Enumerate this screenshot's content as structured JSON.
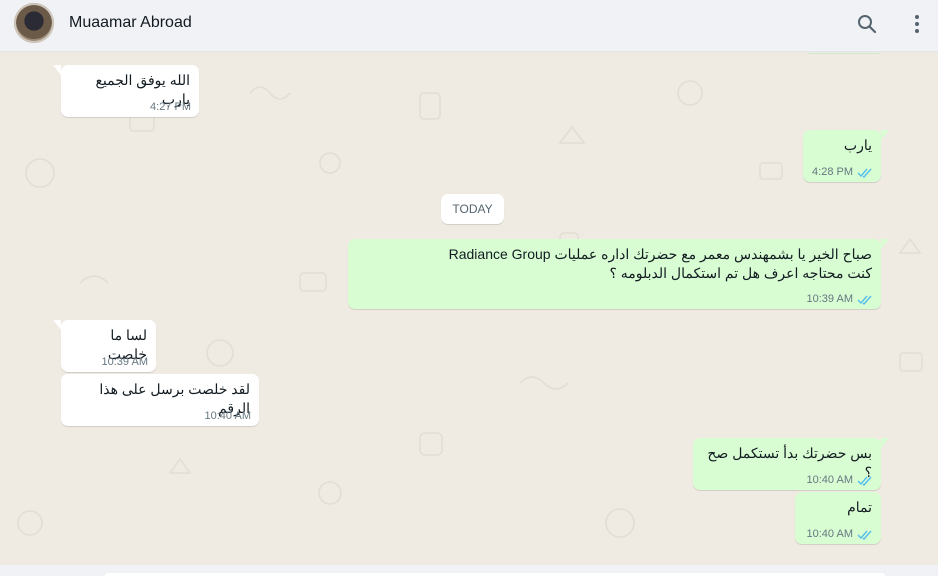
{
  "header": {
    "contact_name": "Muaamar Abroad",
    "search_icon": "search-icon",
    "menu_icon": "more-vertical-icon"
  },
  "date_separator": "TODAY",
  "messages": [
    {
      "direction": "incoming",
      "text": "الله يوفق الجميع يارب",
      "time": "4:27 PM"
    },
    {
      "direction": "outgoing",
      "text": "يارب",
      "time": "4:28 PM",
      "status": "read"
    },
    {
      "direction": "outgoing",
      "text": "صباح الخير يا بشمهندس معمر مع حضرتك اداره عمليات Radiance Group\nكنت محتاجه اعرف هل تم استكمال الدبلومه  ؟",
      "time": "10:39 AM",
      "status": "read"
    },
    {
      "direction": "incoming",
      "text": "لسا ما خلصت",
      "time": "10:39 AM"
    },
    {
      "direction": "incoming",
      "text": "لقد خلصت برسل على هذا الرقم",
      "time": "10:40 AM"
    },
    {
      "direction": "outgoing",
      "text": "بس حضرتك بدأ تستكمل صح ؟",
      "time": "10:40 AM",
      "status": "read"
    },
    {
      "direction": "outgoing",
      "text": "تمام",
      "time": "10:40 AM",
      "status": "read"
    }
  ],
  "colors": {
    "chat_bg": "#efeae2",
    "incoming_bubble": "#ffffff",
    "outgoing_bubble": "#d9fdd3",
    "read_ticks": "#53bdeb",
    "header_bg": "#f0f2f5"
  }
}
